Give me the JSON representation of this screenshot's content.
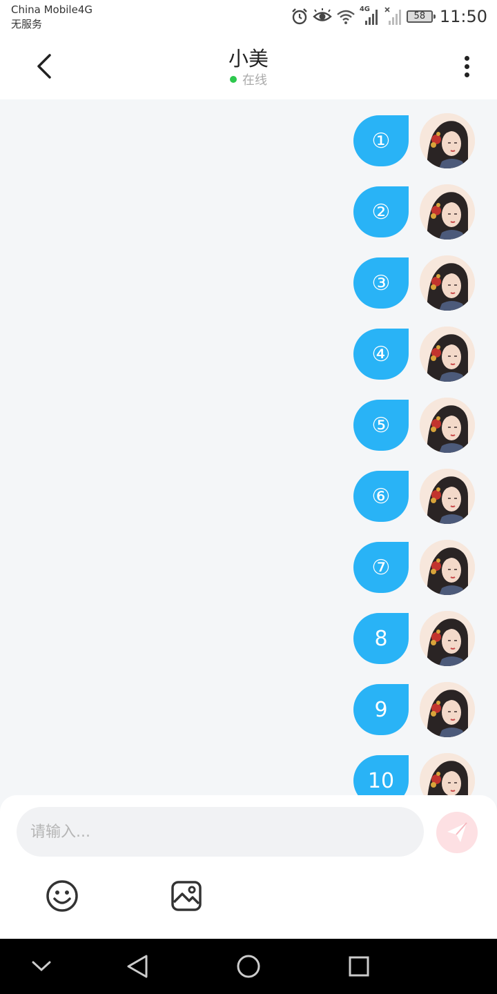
{
  "status_bar": {
    "carrier": "China Mobile4G",
    "service": "无服务",
    "network_badge": "4G",
    "battery": "58",
    "time": "11:50",
    "icons": [
      "alarm-icon",
      "eye-icon",
      "wifi-icon",
      "signal-icon",
      "no-signal-icon",
      "battery-icon"
    ]
  },
  "header": {
    "title": "小美",
    "status": "在线",
    "status_color": "#2dc84d"
  },
  "messages": [
    {
      "text": "①"
    },
    {
      "text": "②"
    },
    {
      "text": "③"
    },
    {
      "text": "④"
    },
    {
      "text": "⑤"
    },
    {
      "text": "⑥"
    },
    {
      "text": "⑦"
    },
    {
      "text": "8"
    },
    {
      "text": "9"
    },
    {
      "text": "10"
    }
  ],
  "bubble_color": "#29b3f6",
  "input": {
    "placeholder": "请输入...",
    "value": ""
  },
  "toolbar": {
    "emoji_icon": "smiley-icon",
    "image_icon": "image-icon",
    "send_icon": "paper-plane-icon",
    "send_color": "#fde0e3"
  },
  "nav": {
    "icons": [
      "chevron-down-icon",
      "back-triangle-icon",
      "home-circle-icon",
      "recents-square-icon"
    ]
  }
}
